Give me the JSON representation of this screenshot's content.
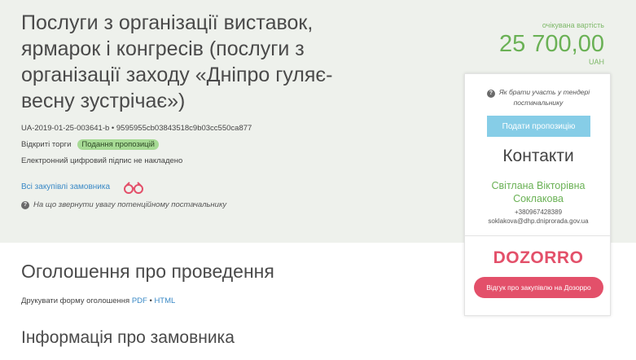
{
  "tender": {
    "title": "Послуги з організації виставок, ярмарок і конгресів (послуги з організації заходу «Дніпро гуляє-весну зустрічає»)",
    "id": "UA-2019-01-25-003641-b",
    "separator": "•",
    "hash": "9595955cb03843518c9b03cc550ca877",
    "procedure": "Відкриті торги",
    "status_badge": "Подання пропозицій",
    "signature_status": "Електронний цифровий підпис не накладено",
    "all_purchases_link": "Всі закупівлі замовника",
    "attention_hint": "На що звернути увагу потенційному постачальнику"
  },
  "expected_value": {
    "label": "очікувана вартість",
    "amount": "25 700,00",
    "currency": "UAH"
  },
  "card": {
    "how_to_participate": "Як брати участь у тендері постачальнику",
    "submit_button": "Подати пропозицію",
    "contacts_title": "Контакти",
    "contact_name": "Світлана Вікторівна Соклакова",
    "phone": "+380967428389",
    "email": "soklakova@dhp.dniprorada.gov.ua",
    "logo_text": "DOZORRO",
    "feedback_button": "Відгук про закупівлю на Дозорро"
  },
  "announcement": {
    "title": "Оголошення про проведення",
    "print_label": "Друкувати форму оголошення",
    "pdf": "PDF",
    "separator": "•",
    "html": "HTML"
  },
  "customer_info": {
    "title": "Інформація про замовника"
  },
  "colors": {
    "accent_green": "#6ab155",
    "link_blue": "#3a89c6",
    "dozorro_red": "#e3506a",
    "badge_green": "#a6da94"
  },
  "icons": {
    "hint": "question-circle-icon",
    "binoculars": "binoculars-icon"
  }
}
